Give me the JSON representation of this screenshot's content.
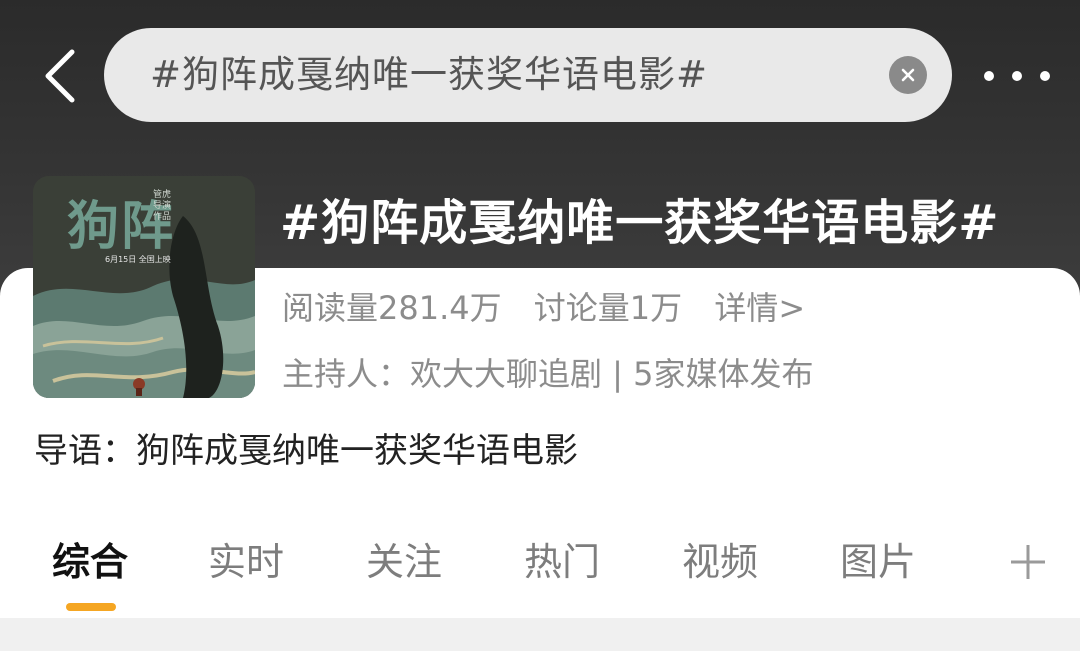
{
  "search": {
    "query": "#狗阵成戛纳唯一获奖华语电影#"
  },
  "topic": {
    "title": "#狗阵成戛纳唯一获奖华语电影#",
    "reads": "阅读量281.4万",
    "discussions": "讨论量1万",
    "details_link": "详情>",
    "host": "主持人：欢大大聊追剧 | 5家媒体发布",
    "intro": "导语：狗阵成戛纳唯一获奖华语电影"
  },
  "poster": {
    "title_text": "狗阵",
    "small_text": "管虎 导演作品",
    "date_text": "6月15日 全国上映"
  },
  "tabs": [
    {
      "label": "综合",
      "active": true
    },
    {
      "label": "实时",
      "active": false
    },
    {
      "label": "关注",
      "active": false
    },
    {
      "label": "热门",
      "active": false
    },
    {
      "label": "视频",
      "active": false
    },
    {
      "label": "图片",
      "active": false
    }
  ],
  "colors": {
    "accent": "#f5a623",
    "header_bg": "#2f2f2f"
  },
  "icons": {
    "back": "chevron-left-icon",
    "clear": "clear-icon",
    "more": "more-dots-icon",
    "add_tab": "plus-icon"
  }
}
